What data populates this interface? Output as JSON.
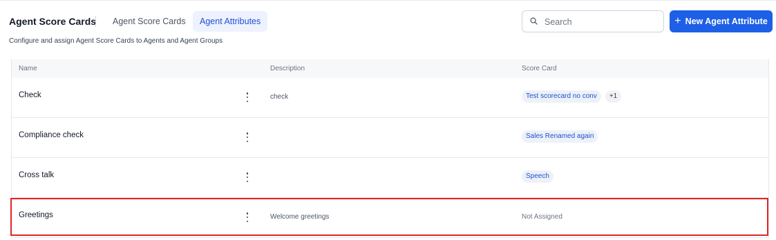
{
  "header": {
    "title": "Agent Score Cards",
    "tabs": [
      {
        "label": "Agent Score Cards",
        "active": false
      },
      {
        "label": "Agent Attributes",
        "active": true
      }
    ],
    "search_placeholder": "Search",
    "new_button_label": "New Agent Attribute",
    "new_button_icon": "plus-icon",
    "subtitle": "Configure and assign Agent Score Cards to Agents and Agent Groups"
  },
  "table": {
    "columns": [
      "Name",
      "Description",
      "Score Card"
    ],
    "rows": [
      {
        "name": "Check",
        "description": "check",
        "score_cards": [
          "Test scorecard no conv"
        ],
        "more": "+1"
      },
      {
        "name": "Compliance check",
        "description": "",
        "score_cards": [
          "Sales Renamed again"
        ]
      },
      {
        "name": "Cross talk",
        "description": "",
        "score_cards": [
          "Speech"
        ]
      },
      {
        "name": "Greetings",
        "description": "Welcome greetings",
        "score_cards": [],
        "status": "Not Assigned",
        "highlighted": true
      }
    ]
  },
  "colors": {
    "accent": "#1d5fe6",
    "active_tab_bg": "#eef2ff",
    "chip_text": "#1d4ed8",
    "highlight_border": "#e02424"
  }
}
